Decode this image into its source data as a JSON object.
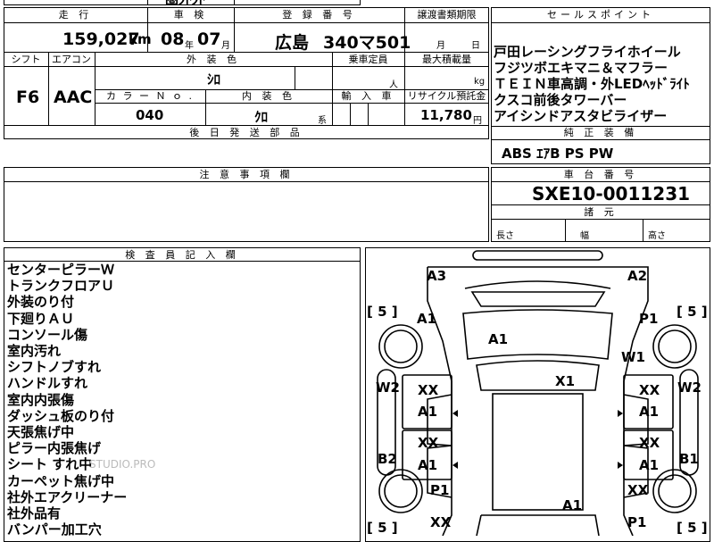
{
  "top_partial": "圏外外",
  "header": {
    "mileage_label": "走 行",
    "inspection_label": "車 検",
    "registration_label": "登 録 番 号",
    "transfer_label": "譲渡書類期限",
    "selling_label": "セールスポイント"
  },
  "vehicle": {
    "mileage": "159,027",
    "mileage_unit": "km",
    "inspection_year": "08",
    "year_unit": "年",
    "inspection_month": "07",
    "month_unit": "月",
    "plate_region": "広島",
    "plate_number": "340マ501",
    "transfer_month_unit": "月",
    "transfer_day_unit": "日"
  },
  "row2": {
    "shift_label": "シフト",
    "ac_label": "エアコン",
    "ext_color_label": "外 装 色",
    "capacity_label": "乗車定員",
    "max_load_label": "最大積載量",
    "shift": "F6",
    "ac": "AAC",
    "ext_color": "ｼﾛ",
    "capacity_unit": "人",
    "load_unit": "kg",
    "color_no_label": "カ ラ ー Ｎ ｏ .",
    "interior_color_label": "内 装 色",
    "import_label": "輸 入 車",
    "recycle_label": "リサイクル預託金",
    "color_no": "040",
    "interior_color": "ｸﾛ",
    "interior_unit": "系",
    "recycle": "11,780",
    "recycle_unit": "円"
  },
  "later_parts_label": "後 日 発 送 部 品",
  "notes_label": "注 意 事 項 欄",
  "selling_points": [
    "戸田レーシングフライホイール",
    "フジツボエキマニ＆マフラー",
    "ＴＥＩＮ車高調・外LEDﾍｯﾄﾞﾗｲﾄ",
    "クスコ前後タワーバー",
    "アイシンドアスタビライザー"
  ],
  "genuine_label": "純 正 装 備",
  "genuine_equipment": "ABS ｴｱB PS PW",
  "chassis_label": "車 台 番 号",
  "chassis_number": "SXE10-0011231",
  "dimensions_label": "諸 元",
  "length_label": "長さ",
  "width_label": "幅",
  "height_label": "高さ",
  "inspector_label": "検 査 員 記 入 欄",
  "inspector_notes": [
    "センターピラーＷ",
    "トランクフロアＵ",
    "外装のり付",
    "下廻りＡＵ",
    "コンソール傷",
    "室内汚れ",
    "シフトノブすれ",
    "ハンドルすれ",
    "室内内張傷",
    "ダッシュ板のり付",
    "天張焦げ中",
    "ピラー内張焦げ",
    "シート すれ中",
    "カーペット焦げ中",
    "社外エアクリーナー",
    "社外品有",
    "バンパー加工穴"
  ],
  "watermark": "STUDIO.PRO",
  "diagram": {
    "front_left_corner": "A3",
    "front_right_corner": "A2",
    "tire_fl": "5",
    "tire_fr": "5",
    "tire_rl": "5",
    "tire_rr": "5",
    "fender_left": "A1",
    "fender_right": "P1",
    "hood": "A1",
    "front_right_wheel": "W1",
    "roof": "X1",
    "left_wheel_front": "W2",
    "right_wheel_front": "W2",
    "front_left_door_a": "XX",
    "front_left_door_b": "A1",
    "front_right_door_a": "XX",
    "front_right_door_b": "A1",
    "rear_left_door_a": "XX",
    "rear_left_door_b": "A1",
    "rear_right_door_a": "XX",
    "rear_right_door_b": "A1",
    "left_rocker": "B2",
    "right_rocker": "B1",
    "rear_left_fender": "P1",
    "rear_right_fender_xx": "XX",
    "trunk": "A1",
    "rear_right_corner": "P1",
    "rear_left_bottom": "XX"
  }
}
